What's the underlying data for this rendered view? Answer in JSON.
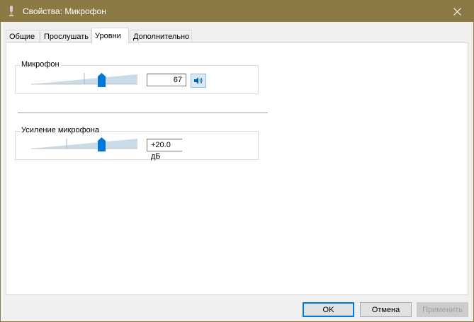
{
  "window": {
    "title": "Свойства: Микрофон",
    "icon": "microphone-icon",
    "titlebar_color": "#8c7a44"
  },
  "tabs": [
    {
      "label": "Общие",
      "active": false
    },
    {
      "label": "Прослушать",
      "active": false
    },
    {
      "label": "Уровни",
      "active": true
    },
    {
      "label": "Дополнительно",
      "active": false
    }
  ],
  "levels": {
    "microphone": {
      "label": "Микрофон",
      "value": "67",
      "slider_level": 0.67,
      "mute_icon": "speaker-icon"
    },
    "boost": {
      "label": "Усиление микрофона",
      "value": "+20.0 дБ",
      "slider_level": 0.67
    }
  },
  "footer": {
    "ok_label": "OK",
    "cancel_label": "Отмена",
    "apply_label": "Применить"
  },
  "colors": {
    "accent": "#0078d7",
    "slider_thumb": "#0078d7"
  }
}
